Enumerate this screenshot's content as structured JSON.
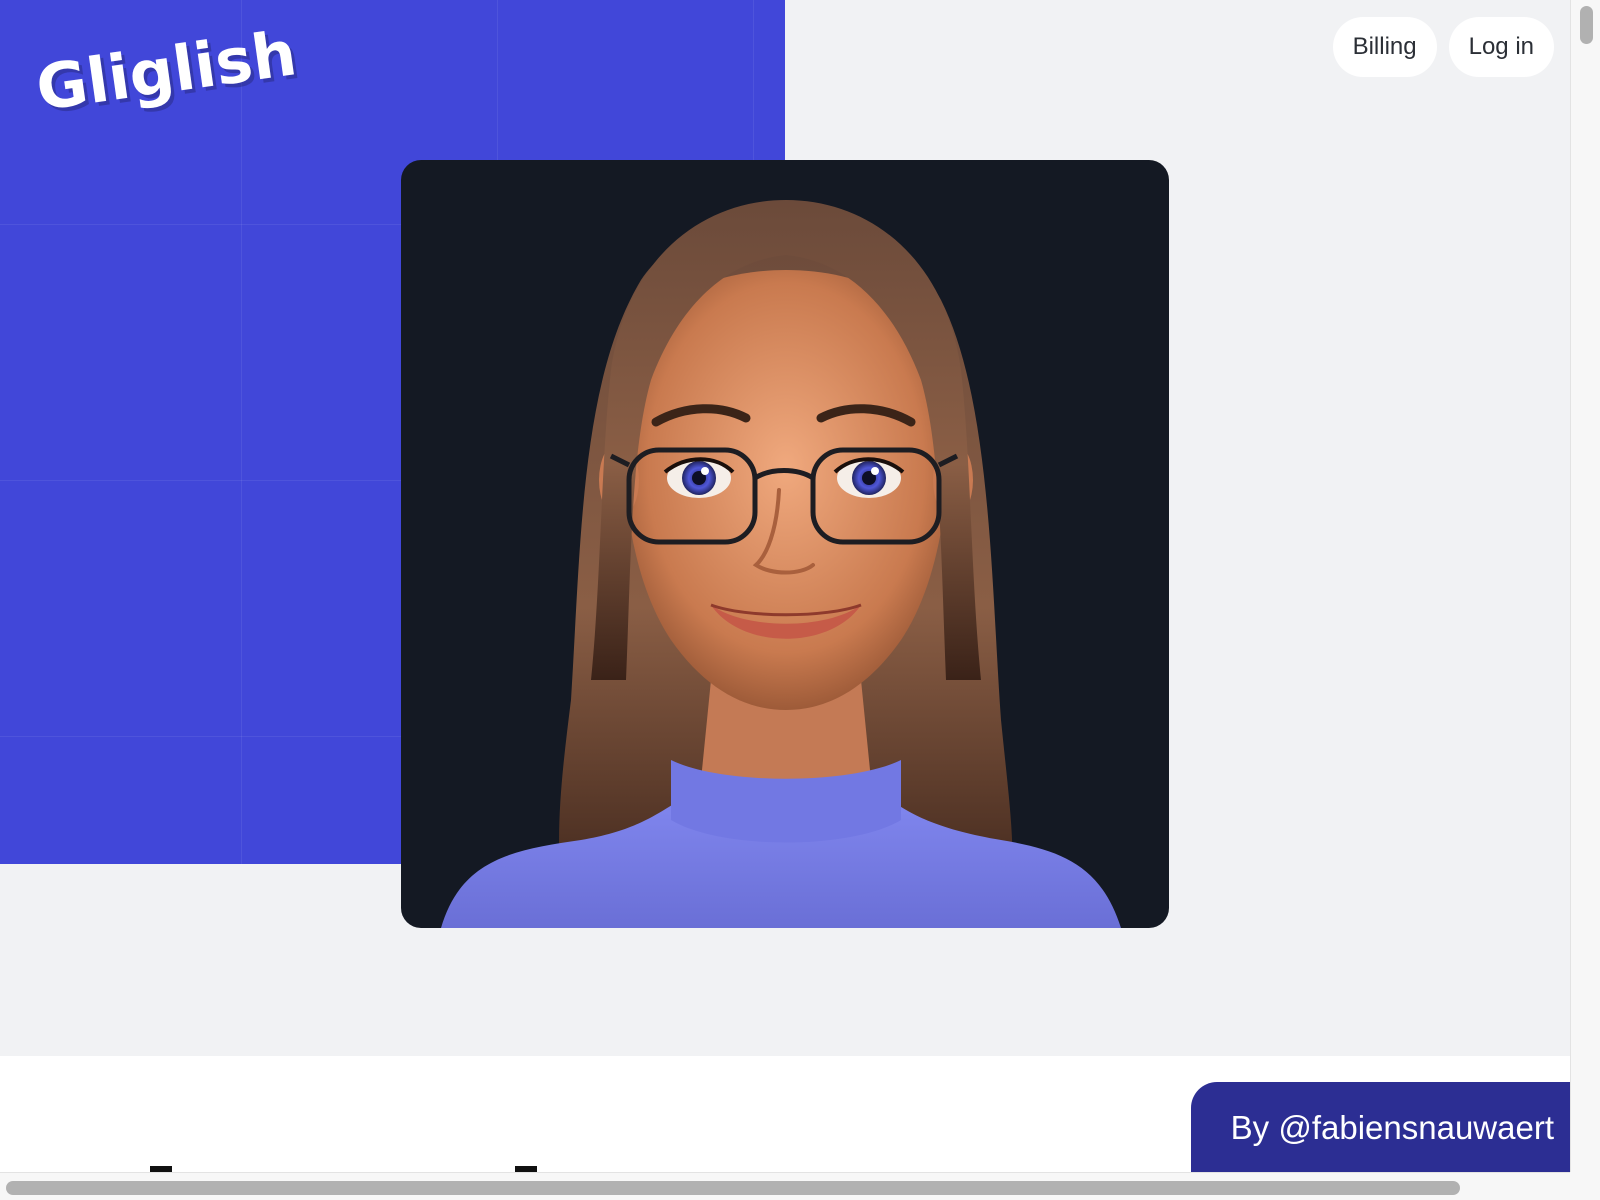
{
  "brand": {
    "logo_text": "Gliglish"
  },
  "nav": {
    "billing_label": "Billing",
    "login_label": "Log in"
  },
  "hero": {
    "avatar_description_icon": "avatar-portrait-image"
  },
  "footer_banner": {
    "author_label": "By @fabiensnauwaert"
  },
  "colors": {
    "brand_blue": "#4147d9",
    "badge_blue": "#2c2e93",
    "page_bg": "#f1f2f4",
    "card_bg": "#141923"
  }
}
